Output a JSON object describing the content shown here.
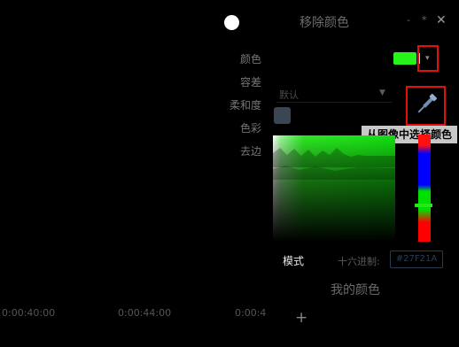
{
  "dialog": {
    "title": "移除颜色",
    "minimize_glyph": "-",
    "pin_glyph": "*",
    "close_glyph": "✕"
  },
  "sidebar": {
    "items": [
      {
        "label": "颜色"
      },
      {
        "label": "容差"
      },
      {
        "label": "柔和度"
      },
      {
        "label": "色彩"
      },
      {
        "label": "去边"
      }
    ]
  },
  "color": {
    "current": "#27f21a",
    "dropdown_glyph": "▾"
  },
  "preset": {
    "value": "默认",
    "arrow_glyph": "▼"
  },
  "eyedropper": {
    "icon": "eyedropper-icon",
    "tooltip": "从图像中选择颜色"
  },
  "mode": {
    "label": "模式",
    "hex_label": "十六进制:",
    "hex_value": "#27F21A"
  },
  "my_colors": {
    "title": "我的颜色",
    "add_glyph": "+"
  },
  "timeline": {
    "ticks": [
      "0:00:40:00",
      "0:00:44:00",
      "0:00:4"
    ]
  },
  "accent_colors": {
    "highlight_box": "#e01010",
    "selected_green": "#27f21a"
  }
}
